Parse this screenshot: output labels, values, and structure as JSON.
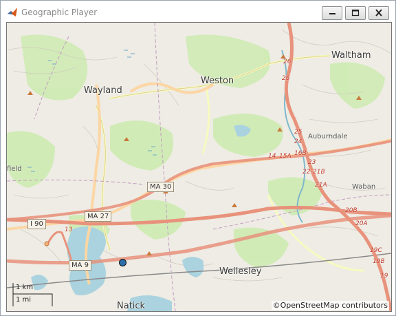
{
  "window": {
    "title": "Geographic Player",
    "buttons": [
      "minimize",
      "maximize",
      "close"
    ]
  },
  "map": {
    "towns": {
      "waltham": "Waltham",
      "wayland": "Wayland",
      "weston": "Weston",
      "wellesley": "Wellesley",
      "natick": "Natick",
      "auburndale": "Auburndale",
      "waban": "Waban",
      "field": "field"
    },
    "shields": {
      "ma30": "MA 30",
      "ma27": "MA 27",
      "ma9": "MA 9",
      "i90": "I 90"
    },
    "exits": {
      "e26a": "26",
      "e26b": "26",
      "e25": "25",
      "e24": "24",
      "e23": "23",
      "e22": "22",
      "e21b": "21B",
      "e21a": "21A",
      "e20b": "20B",
      "e20a": "20A",
      "e19c": "19C",
      "e19b": "19B",
      "e19a": "19",
      "e13": "13",
      "e14": "14",
      "e15": "15A",
      "e16": "16B"
    },
    "scale": {
      "km": "1 km",
      "mi": "1 mi"
    },
    "attribution": "©OpenStreetMap contributors"
  },
  "colors": {
    "motorway": "#e8927c",
    "trunk": "#f3b179",
    "primary": "#fcd6a4",
    "secondary": "#f7fabf",
    "water": "#aad3df",
    "park": "#cdebb0",
    "marker": "#2b6ea8"
  }
}
